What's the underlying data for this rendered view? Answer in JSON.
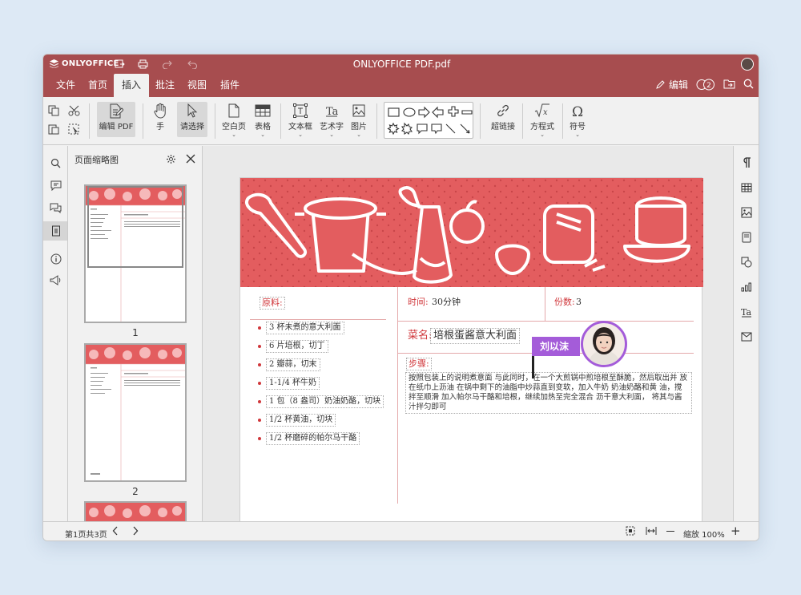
{
  "titlebar": {
    "logo": "ONLYOFFICE",
    "doc_title": "ONLYOFFICE PDF.pdf"
  },
  "menu": {
    "tabs": [
      "文件",
      "首页",
      "插入",
      "批注",
      "视图",
      "插件"
    ],
    "active": "插入",
    "edit_label": "编辑",
    "users_count": "2"
  },
  "toolbar": {
    "edit_pdf": "编辑 PDF",
    "hand": "手",
    "select": "请选择",
    "blank_page": "空白页",
    "table": "表格",
    "textbox": "文本框",
    "art_text": "艺术字",
    "image": "图片",
    "hyperlink": "超链接",
    "equation": "方程式",
    "symbol": "符号"
  },
  "thumbnails": {
    "title": "页面缩略图",
    "pages": [
      "1",
      "2"
    ]
  },
  "document": {
    "ingredients_label": "原料:",
    "ingredients": [
      "3 杯未煮的意大利面",
      "6 片培根，切丁",
      "2 瓣蒜，切末",
      "1-1/4 杯牛奶",
      "1 包（8 盎司）奶油奶酪，切块",
      "1/2 杯黄油，切块",
      "1/2 杯磨碎的帕尔马干酪"
    ],
    "time_label": "时间:",
    "time_value": "30分钟",
    "servings_label": "份数:",
    "servings_value": "3",
    "dish_label": "菜名:",
    "dish_value": "培根蛋酱意大利面",
    "steps_label": "步骤:",
    "steps_text": "按照包装上的说明煮意面  与此同时，在一个大煎锅中煎培根至酥脆，然后取出并 放在纸巾上沥油  在锅中剩下的油脂中炒蒜直到变软，加入牛奶 奶油奶酪和黄 油，搅拌至顺滑  加入帕尔马干酪和培根，继续加热至完全混合  沥干意大利面，  将其与酱汁拌匀即可",
    "collaborator": "刘以沫"
  },
  "statusbar": {
    "page_info": "第1页共3页",
    "zoom": "缩放 100%"
  },
  "colors": {
    "brand": "#a74d4f",
    "accent_red": "#e35d5f",
    "label_red": "#d0373b"
  }
}
